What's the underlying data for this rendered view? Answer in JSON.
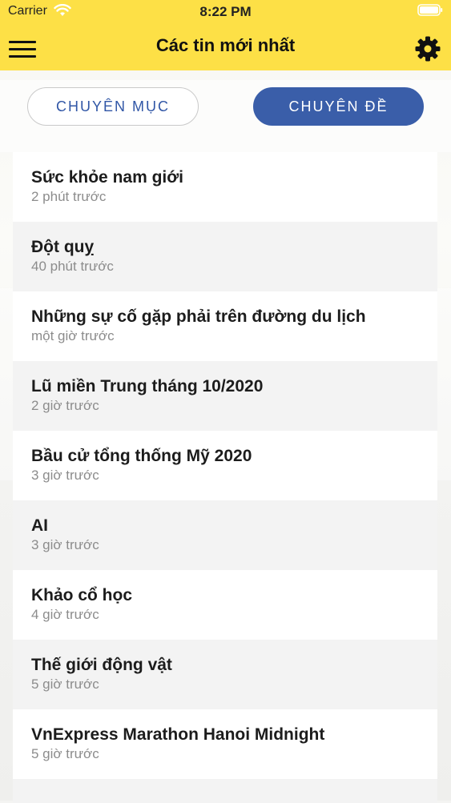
{
  "status_bar": {
    "carrier": "Carrier",
    "time": "8:22 PM"
  },
  "header": {
    "title": "Các tin mới nhất"
  },
  "segments": {
    "left_label": "CHUYÊN MỤC",
    "right_label": "CHUYÊN ĐỀ",
    "selected": "CHUYÊN ĐỀ"
  },
  "colors": {
    "header": "#fde046",
    "accent": "#3a5ea9"
  },
  "items": [
    {
      "title": "Sức khỏe nam giới",
      "time": "2 phút trước"
    },
    {
      "title": "Đột quỵ",
      "time": "40 phút trước"
    },
    {
      "title": "Những sự cố gặp phải trên đường du lịch",
      "time": "một giờ trước"
    },
    {
      "title": "Lũ miền Trung tháng 10/2020",
      "time": "2 giờ trước"
    },
    {
      "title": "Bầu cử tổng thống Mỹ 2020",
      "time": "3 giờ trước"
    },
    {
      "title": "AI",
      "time": "3 giờ trước"
    },
    {
      "title": "Khảo cổ học",
      "time": "4 giờ trước"
    },
    {
      "title": "Thế giới động vật",
      "time": "5 giờ trước"
    },
    {
      "title": "VnExpress Marathon Hanoi Midnight",
      "time": "5 giờ trước"
    }
  ],
  "icons": {
    "menu": "hamburger-menu-icon",
    "settings": "gear-icon",
    "wifi": "wifi-icon",
    "battery": "battery-icon"
  }
}
